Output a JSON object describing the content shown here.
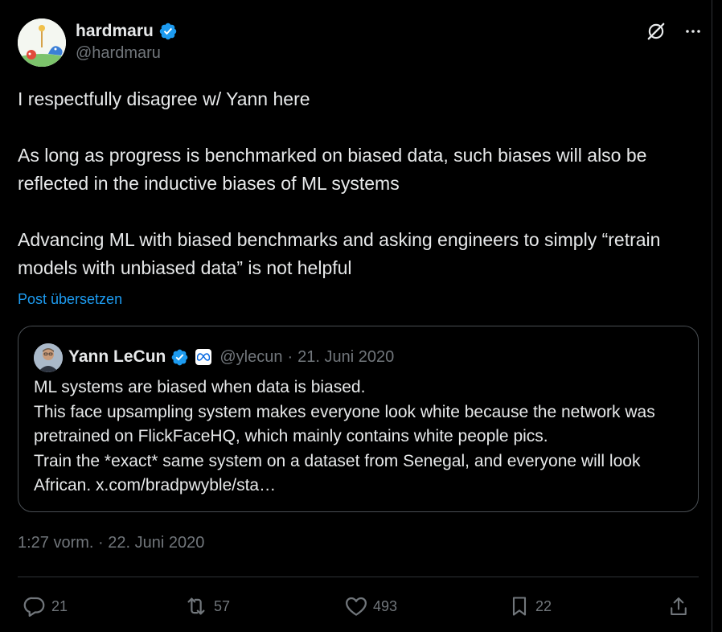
{
  "author": {
    "name": "hardmaru",
    "handle": "@hardmaru",
    "verified_icon": "verified-badge-icon"
  },
  "header_icons": [
    "grok-icon",
    "more-icon"
  ],
  "tweet": {
    "paragraphs": [
      "I respectfully disagree w/ Yann here",
      "As long as progress is benchmarked on biased data, such biases will also be reflected in the inductive biases of ML systems",
      "Advancing ML with biased benchmarks and asking engineers to simply “retrain models with unbiased data” is not helpful"
    ],
    "translate_label": "Post übersetzen"
  },
  "quote": {
    "name": "Yann LeCun",
    "handle": "@ylecun",
    "separator": "·",
    "date": "21. Juni 2020",
    "lines": [
      "ML systems are biased when data is biased.",
      "This face upsampling system makes everyone look white because the network was pretrained on FlickFaceHQ, which mainly contains white people pics.",
      "Train the *exact* same system on a dataset from Senegal, and everyone will look African. x.com/bradpwyble/sta…"
    ]
  },
  "timestamp": "1:27 vorm. · 22. Juni 2020",
  "actions": {
    "replies": "21",
    "reposts": "57",
    "likes": "493",
    "bookmarks": "22"
  },
  "colors": {
    "background": "#000000",
    "text": "#e7e9ea",
    "muted": "#71767b",
    "accent": "#1d9bf0",
    "border": "#2f3336"
  }
}
